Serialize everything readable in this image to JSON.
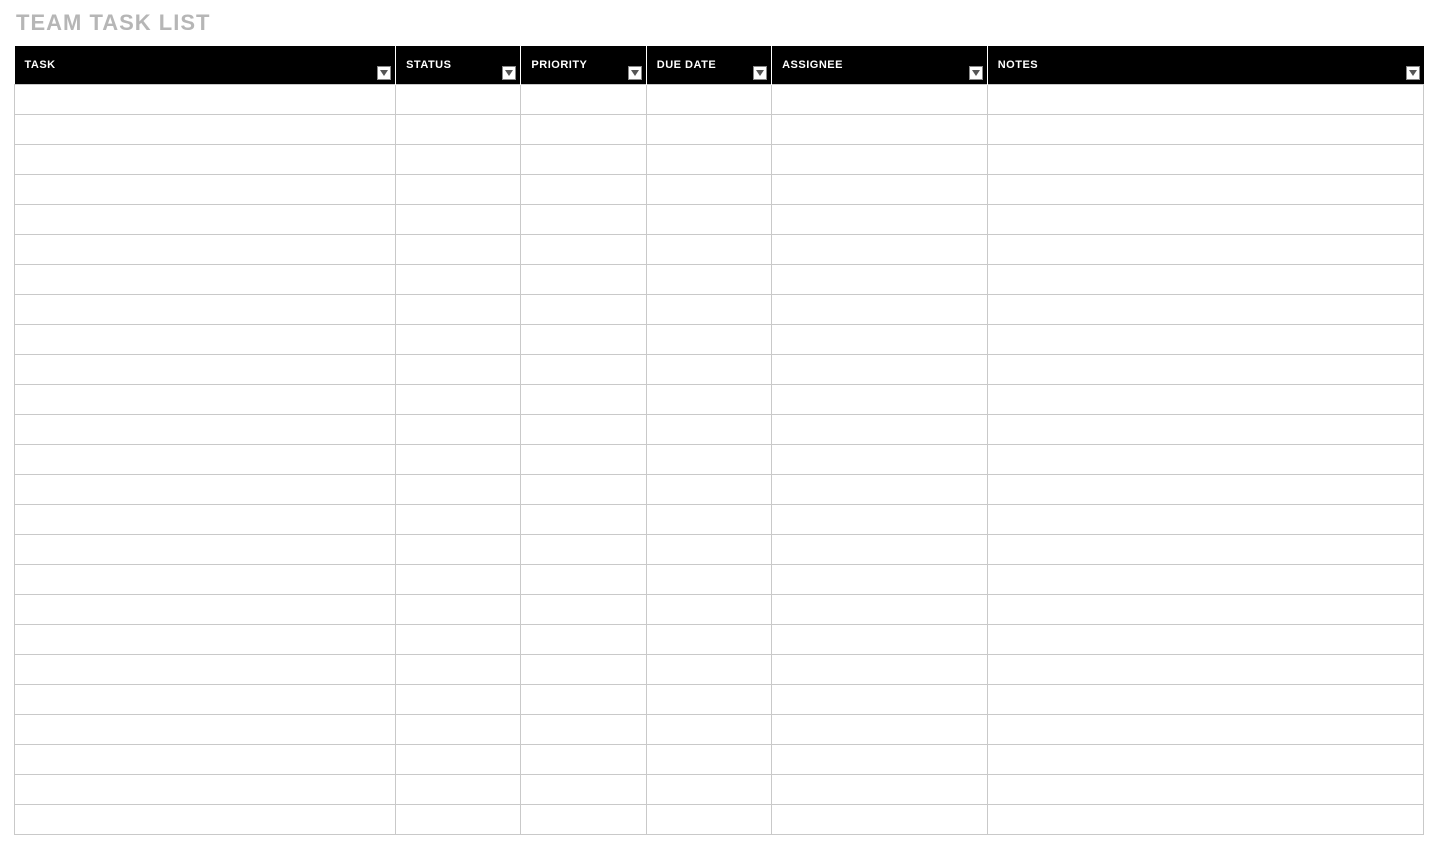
{
  "title": "TEAM TASK LIST",
  "columns": {
    "task": {
      "label": "TASK",
      "filter": true
    },
    "status": {
      "label": "STATUS",
      "filter": true
    },
    "priority": {
      "label": "PRIORITY",
      "filter": true
    },
    "duedate": {
      "label": "DUE DATE",
      "filter": true
    },
    "assignee": {
      "label": "ASSIGNEE",
      "filter": true
    },
    "notes": {
      "label": "NOTES",
      "filter": true
    }
  },
  "rows": [
    {
      "task": "",
      "status": "",
      "priority": "",
      "duedate": "",
      "assignee": "",
      "notes": ""
    },
    {
      "task": "",
      "status": "",
      "priority": "",
      "duedate": "",
      "assignee": "",
      "notes": ""
    },
    {
      "task": "",
      "status": "",
      "priority": "",
      "duedate": "",
      "assignee": "",
      "notes": ""
    },
    {
      "task": "",
      "status": "",
      "priority": "",
      "duedate": "",
      "assignee": "",
      "notes": ""
    },
    {
      "task": "",
      "status": "",
      "priority": "",
      "duedate": "",
      "assignee": "",
      "notes": ""
    },
    {
      "task": "",
      "status": "",
      "priority": "",
      "duedate": "",
      "assignee": "",
      "notes": ""
    },
    {
      "task": "",
      "status": "",
      "priority": "",
      "duedate": "",
      "assignee": "",
      "notes": ""
    },
    {
      "task": "",
      "status": "",
      "priority": "",
      "duedate": "",
      "assignee": "",
      "notes": ""
    },
    {
      "task": "",
      "status": "",
      "priority": "",
      "duedate": "",
      "assignee": "",
      "notes": ""
    },
    {
      "task": "",
      "status": "",
      "priority": "",
      "duedate": "",
      "assignee": "",
      "notes": ""
    },
    {
      "task": "",
      "status": "",
      "priority": "",
      "duedate": "",
      "assignee": "",
      "notes": ""
    },
    {
      "task": "",
      "status": "",
      "priority": "",
      "duedate": "",
      "assignee": "",
      "notes": ""
    },
    {
      "task": "",
      "status": "",
      "priority": "",
      "duedate": "",
      "assignee": "",
      "notes": ""
    },
    {
      "task": "",
      "status": "",
      "priority": "",
      "duedate": "",
      "assignee": "",
      "notes": ""
    },
    {
      "task": "",
      "status": "",
      "priority": "",
      "duedate": "",
      "assignee": "",
      "notes": ""
    },
    {
      "task": "",
      "status": "",
      "priority": "",
      "duedate": "",
      "assignee": "",
      "notes": ""
    },
    {
      "task": "",
      "status": "",
      "priority": "",
      "duedate": "",
      "assignee": "",
      "notes": ""
    },
    {
      "task": "",
      "status": "",
      "priority": "",
      "duedate": "",
      "assignee": "",
      "notes": ""
    },
    {
      "task": "",
      "status": "",
      "priority": "",
      "duedate": "",
      "assignee": "",
      "notes": ""
    },
    {
      "task": "",
      "status": "",
      "priority": "",
      "duedate": "",
      "assignee": "",
      "notes": ""
    },
    {
      "task": "",
      "status": "",
      "priority": "",
      "duedate": "",
      "assignee": "",
      "notes": ""
    },
    {
      "task": "",
      "status": "",
      "priority": "",
      "duedate": "",
      "assignee": "",
      "notes": ""
    },
    {
      "task": "",
      "status": "",
      "priority": "",
      "duedate": "",
      "assignee": "",
      "notes": ""
    },
    {
      "task": "",
      "status": "",
      "priority": "",
      "duedate": "",
      "assignee": "",
      "notes": ""
    },
    {
      "task": "",
      "status": "",
      "priority": "",
      "duedate": "",
      "assignee": "",
      "notes": ""
    }
  ]
}
